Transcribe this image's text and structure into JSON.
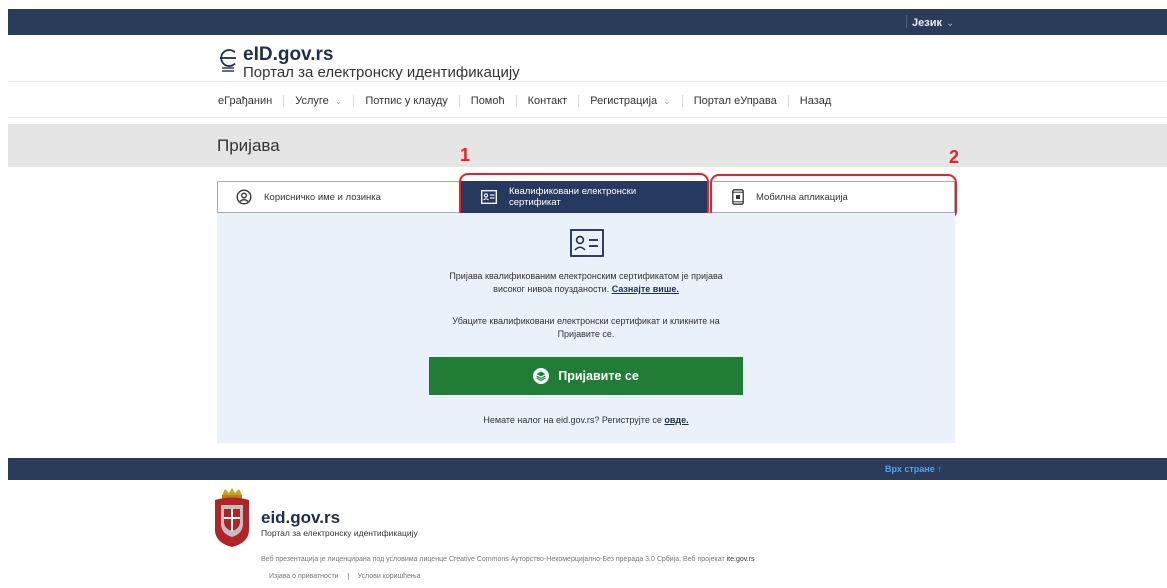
{
  "topbar": {
    "language_label": "Језик"
  },
  "header": {
    "site_name": "eID.gov.rs",
    "site_subtitle": "Портал за електронску идентификацију"
  },
  "nav": {
    "items": [
      {
        "label": "еГрађанин",
        "dropdown": false
      },
      {
        "label": "Услуге",
        "dropdown": true
      },
      {
        "label": "Потпис у клауду",
        "dropdown": false
      },
      {
        "label": "Помоћ",
        "dropdown": false
      },
      {
        "label": "Контакт",
        "dropdown": false
      },
      {
        "label": "Регистрација",
        "dropdown": true
      },
      {
        "label": "Портал еУправа",
        "dropdown": false
      },
      {
        "label": "Назад",
        "dropdown": false
      }
    ]
  },
  "page": {
    "title": "Пријава"
  },
  "tabs": [
    {
      "label": "Корисничко име и лозинка",
      "icon": "user-circle-icon",
      "active": false
    },
    {
      "label_line1": "Квалификовани електронски",
      "label_line2": "сертификат",
      "icon": "id-card-icon",
      "active": true
    },
    {
      "label": "Мобилна апликација",
      "icon": "mobile-phone-icon",
      "active": false
    }
  ],
  "annotations": {
    "marker1": "1",
    "marker2": "2"
  },
  "panel": {
    "description_line1": "Пријава квалификованим електронским сертификатом је пријава",
    "description_line2": "високог нивоа поузданости.",
    "learn_more_link": "Сазнајте више.",
    "instruction_line1": "Убаците квалификовани електронски сертификат и кликните на",
    "instruction_line2": "Пријавите се.",
    "login_button": "Пријавите се",
    "no_account_text": "Немате налог на eid.gov.rs? Региструјте се",
    "register_link": "овде."
  },
  "footer": {
    "back_to_top": "Врх стране ↑",
    "site_name": "eid.gov.rs",
    "site_subtitle": "Портал за електронску идентификацију",
    "license_text": "Веб презентација је лиценцирана под условима лиценце Creative Commons Ауторство-Некомерцијално-Без прерада 3.0 Србија. Веб пројекат",
    "license_org": "ite.gov.rs",
    "links": [
      "Изјава о приватности",
      "Услови коришћења"
    ]
  },
  "colors": {
    "header_bar": "#2a3c5a",
    "active_tab": "#263a5f",
    "login_button": "#1f7d36",
    "panel_bg": "#eaf1fb",
    "annotation": "#e8202a"
  }
}
